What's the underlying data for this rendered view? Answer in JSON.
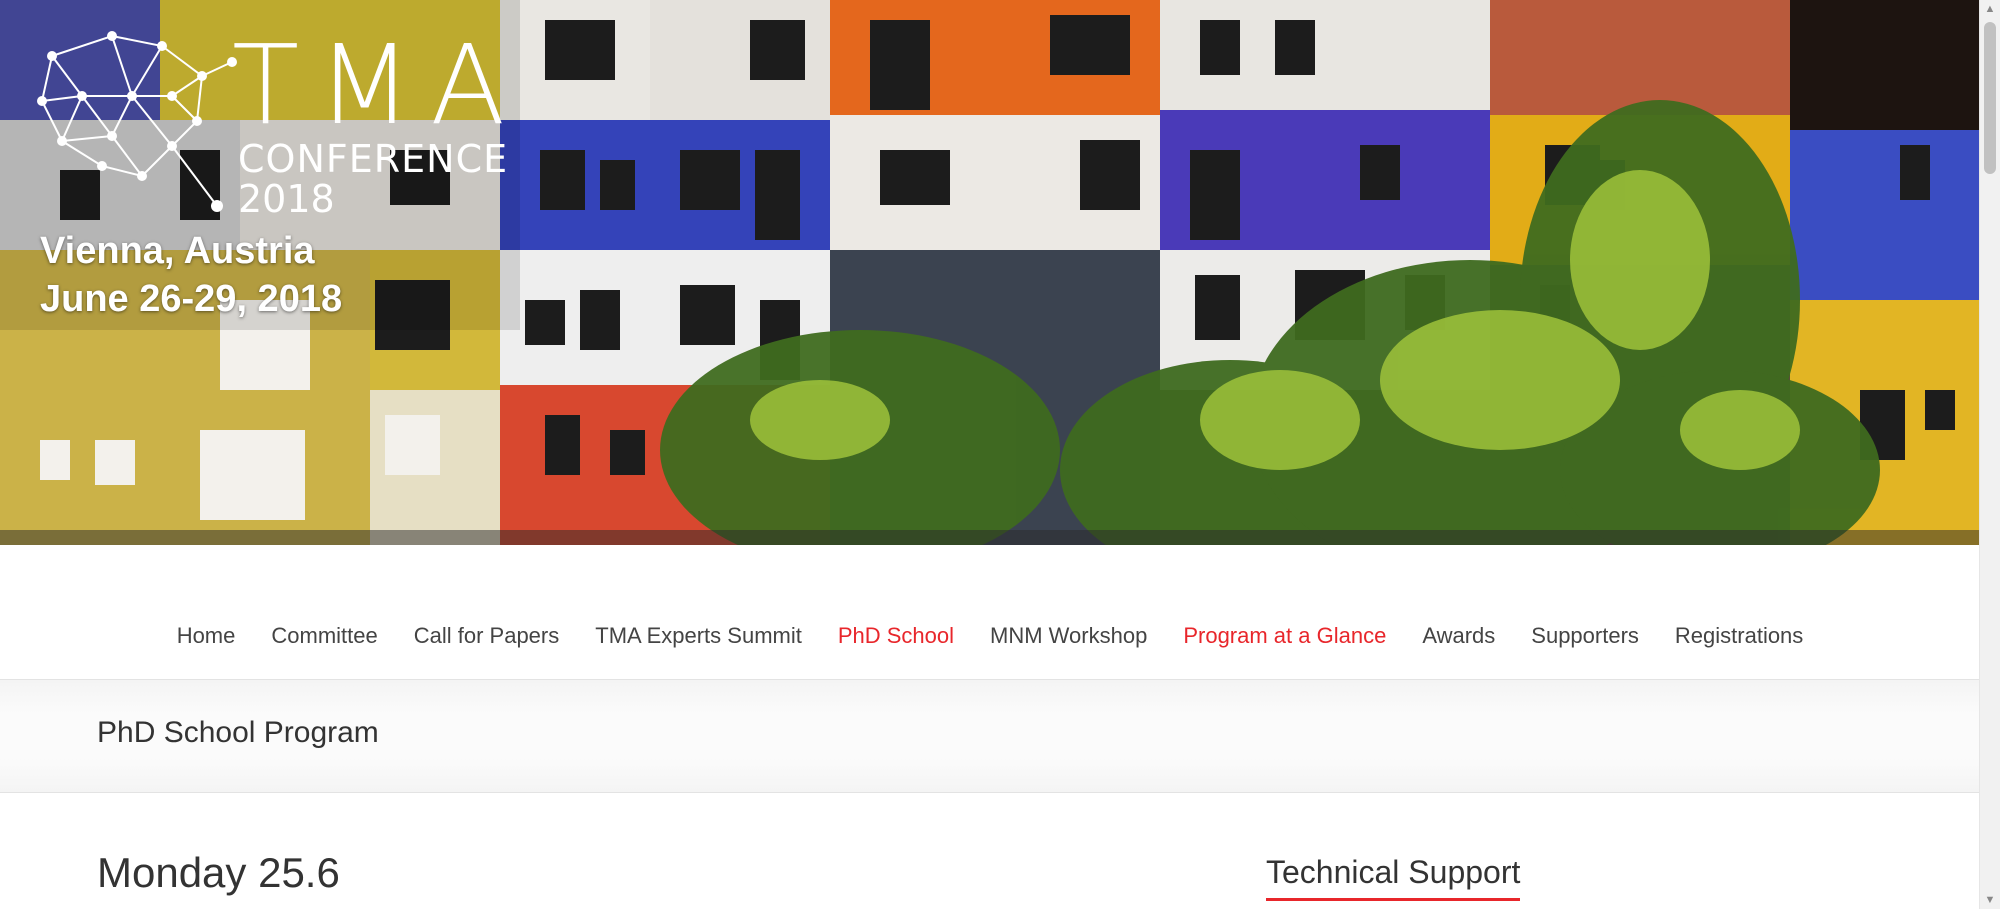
{
  "hero": {
    "logo_tma": "TMA",
    "logo_conference": "CONFERENCE",
    "logo_year": "2018",
    "location": "Vienna, Austria",
    "dates": "June 26-29, 2018"
  },
  "nav": {
    "items": [
      {
        "label": "Home",
        "active": false
      },
      {
        "label": "Committee",
        "active": false
      },
      {
        "label": "Call for Papers",
        "active": false
      },
      {
        "label": "TMA Experts Summit",
        "active": false
      },
      {
        "label": "PhD School",
        "active": true
      },
      {
        "label": "MNM Workshop",
        "active": false
      },
      {
        "label": "Program at a Glance",
        "active": true
      },
      {
        "label": "Awards",
        "active": false
      },
      {
        "label": "Supporters",
        "active": false
      },
      {
        "label": "Registrations",
        "active": false
      }
    ]
  },
  "page_title": "PhD School Program",
  "content": {
    "day_heading": "Monday 25.6"
  },
  "sidebar": {
    "widget_title": "Technical Support"
  },
  "colors": {
    "accent": "#e8262b",
    "nav_text": "#444444",
    "title_bar_bg": "#fbfbfb"
  }
}
